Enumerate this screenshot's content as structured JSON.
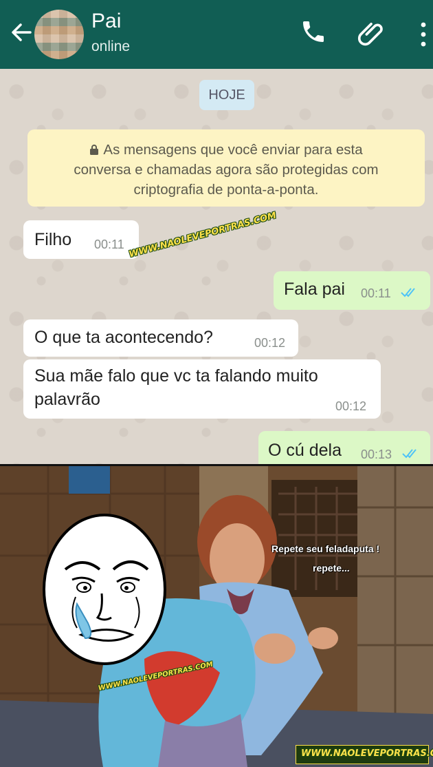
{
  "header": {
    "contact_name": "Pai",
    "status": "online",
    "icons": [
      "back-arrow-icon",
      "avatar",
      "phone-icon",
      "paperclip-icon",
      "more-vert-icon"
    ],
    "bg_color": "#115e54"
  },
  "chat": {
    "date_chip": "HOJE",
    "encryption_notice": {
      "line1": "As mensagens que você enviar para esta",
      "line2": "conversa e chamadas agora são protegidas com",
      "line3": "criptografia de ponta-a-ponta."
    },
    "messages": [
      {
        "direction": "in",
        "text": "Filho",
        "time": "00:11"
      },
      {
        "direction": "out",
        "text": "Fala pai",
        "time": "00:11",
        "status": "read"
      },
      {
        "direction": "in",
        "text": "O que ta acontecendo?",
        "time": "00:12"
      },
      {
        "direction": "in",
        "text_line1": "Sua mãe falo que vc ta falando muito",
        "text_line2": "palavrão",
        "time": "00:12"
      },
      {
        "direction": "out",
        "text": "O cú dela",
        "time": "00:13",
        "status": "read"
      }
    ],
    "watermark": "WWW.NAOLEVEPORTRAS.COM"
  },
  "meme": {
    "caption1": "Repete seu feladaputa !",
    "caption2": "repete...",
    "watermark_small": "WWW.NAOLEVEPORTRAS.COM",
    "watermark_footer": "WWW.NAOLEVEPORTRAS.COM"
  },
  "colors": {
    "header": "#115e54",
    "chat_bg": "#ddd6cd",
    "incoming": "#ffffff",
    "outgoing": "#dcf8c6",
    "notice": "#fdf4c4",
    "read_ticks": "#4fc3f7"
  }
}
